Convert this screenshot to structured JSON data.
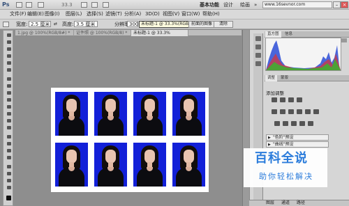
{
  "app": {
    "logo": "Ps",
    "zoom": "33.3",
    "workspace": "基本功能",
    "design": "设计",
    "draw": "绘画",
    "more": "»",
    "watermark_site": "www.16sevnor.com"
  },
  "menu": [
    "文件(F)",
    "编辑(E)",
    "图像(I)",
    "图层(L)",
    "选择(S)",
    "滤镜(T)",
    "分析(A)",
    "3D(D)",
    "视图(V)",
    "窗口(W)",
    "帮助(H)"
  ],
  "options": {
    "width_label": "宽度:",
    "width_value": "2.5 厘米",
    "height_label": "高度:",
    "height_value": "3.5 厘米",
    "res_label": "分辨率:",
    "res_value": "300",
    "tooltip": "未标题-1 @ 33.3%(RGB/8)",
    "front_image": "前面的图像",
    "clear": "清除"
  },
  "tabs": [
    "1.jpg @ 100%(RGB/8#) *",
    "证件照 @ 100%(RGB/8) *",
    "未标题-1 @ 33.3%(RGB/8) *"
  ],
  "panel": {
    "tabs1": [
      "直方图",
      "信息"
    ],
    "tabs2": [
      "调整",
      "蒙版"
    ],
    "adjust_title": "添加调整",
    "presets": [
      "\"色阶\"预设",
      "\"曲线\"预设"
    ],
    "bottom_tabs": [
      "图层",
      "通道",
      "路径"
    ]
  },
  "watermark": {
    "line1": "百科全说",
    "line2": "助你轻松解决"
  },
  "colors": {
    "photo_bg": "#1220d8",
    "accent": "#2b7cdb"
  }
}
